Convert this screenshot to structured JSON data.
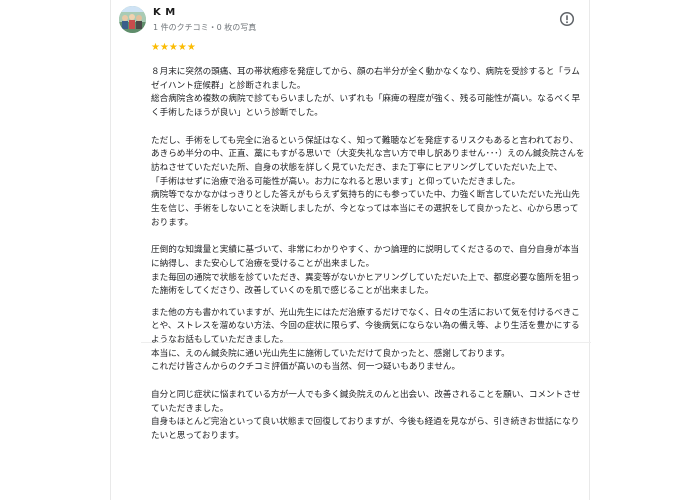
{
  "reviewer": {
    "name": "K M",
    "meta": "1 件のクチコミ・0 枚の写真"
  },
  "rating": {
    "stars": "★★★★★",
    "value": 5
  },
  "icons": {
    "more": "more-vert-icon",
    "star": "star-icon"
  },
  "colors": {
    "star": "#fbbc04",
    "text": "#202124",
    "meta": "#70757a"
  },
  "review": {
    "paragraphs": [
      "８月末に突然の頭痛、耳の帯状疱疹を発症してから、顔の右半分が全く動かなくなり、病院を受診すると「ラムゼイハント症候群」と診断されました。\n総合病院含め複数の病院で診てもらいましたが、いずれも「麻痺の程度が強く、残る可能性が高い。なるべく早く手術したほうが良い」という診断でした。",
      "ただし、手術をしても完全に治るという保証はなく、知って難聴などを発症するリスクもあると言われており、あきらめ半分の中、正直、藁にもすがる思いで（大変失礼な言い方で申し訳ありません･･･）えのん鍼灸院さんを訪ねさせていただいた所、自身の状態を詳しく見ていただき、また丁寧にヒアリングしていただいた上で、\n「手術はせずに治療で治る可能性が高い。お力になれると思います」と仰っていただきました。\n病院等でなかなかはっきりとした答えがもらえず気持ち的にも参っていた中、力強く断言していただいた光山先生を信じ、手術をしないことを決断しましたが、今となっては本当にその選択をして良かったと、心から思っております。",
      "圧倒的な知識量と実績に基づいて、非常にわかりやすく、かつ論理的に説明してくださるので、自分自身が本当に納得し、また安心して治療を受けることが出来ました。\nまた毎回の通院で状態を診ていただき、異変等がないかヒアリングしていただいた上で、都度必要な箇所を狙った施術をしてくださり、改善していくのを肌で感じることが出来ました。",
      "また他の方も書かれていますが、光山先生にはただ治療するだけでなく、日々の生活において気を付けるべきことや、ストレスを溜めない方法、今回の症状に限らず、今後病気にならない為の備え等、より生活を豊かにするようなお話もしていただきました。\n本当に、えのん鍼灸院に通い光山先生に施術していただけて良かったと、感謝しております。\nこれだけ皆さんからのクチコミ評価が高いのも当然、何一つ疑いもありません。",
      "自分と同じ症状に悩まれている方が一人でも多く鍼灸院えのんと出会い、改善されることを願い、コメントさせていただきました。\n自身もほとんど完治といって良い状態まで回復しておりますが、今後も経過を見ながら、引き続きお世話になりたいと思っております。"
    ]
  }
}
